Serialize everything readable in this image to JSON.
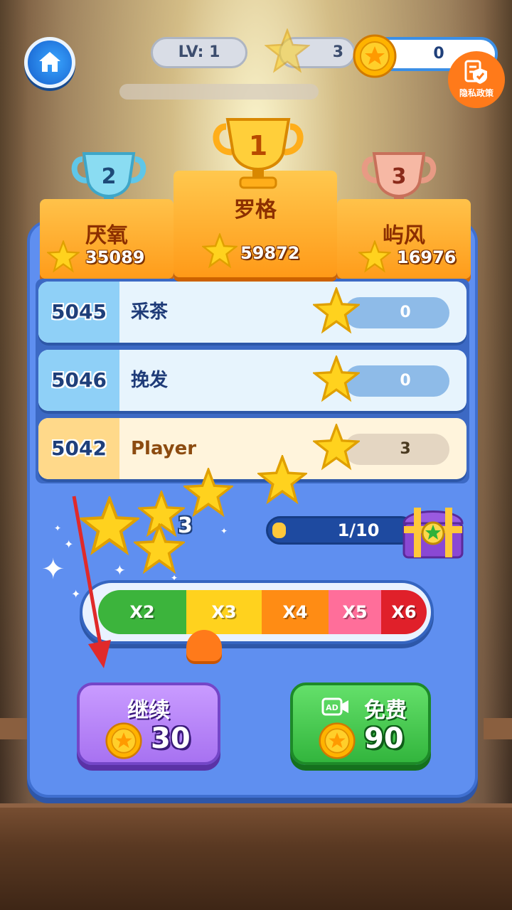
{
  "hud": {
    "level_label": "LV: 1",
    "stars": "3",
    "coins": "0",
    "privacy_label": "隐私政策"
  },
  "podium": [
    {
      "rank": "2",
      "name": "厌氧",
      "score": "35089"
    },
    {
      "rank": "1",
      "name": "罗格",
      "score": "59872"
    },
    {
      "rank": "3",
      "name": "屿风",
      "score": "16976"
    }
  ],
  "leaderboard": [
    {
      "rank": "5045",
      "name": "采茶",
      "stars": "0"
    },
    {
      "rank": "5046",
      "name": "挽发",
      "stars": "0"
    },
    {
      "rank": "5042",
      "name": "Player",
      "stars": "3"
    }
  ],
  "reward": {
    "earned_stars": "3",
    "chest_progress_text": "1/10",
    "chest_progress_value": 0.1
  },
  "multiplier": {
    "segments": [
      "X2",
      "X3",
      "X4",
      "X5",
      "X6"
    ],
    "colors": [
      "#3cb43c",
      "#ffd21e",
      "#ff8c14",
      "#ff6e9a",
      "#e0202a"
    ],
    "selected": "X3"
  },
  "buttons": {
    "continue_label": "继续",
    "continue_value": "30",
    "free_label": "免费",
    "free_ad_label": "AD",
    "free_value": "90"
  },
  "colors": {
    "panel": "#5f8ff0",
    "accent_orange": "#ff9a18",
    "row_highlight": "#fff4dc"
  }
}
